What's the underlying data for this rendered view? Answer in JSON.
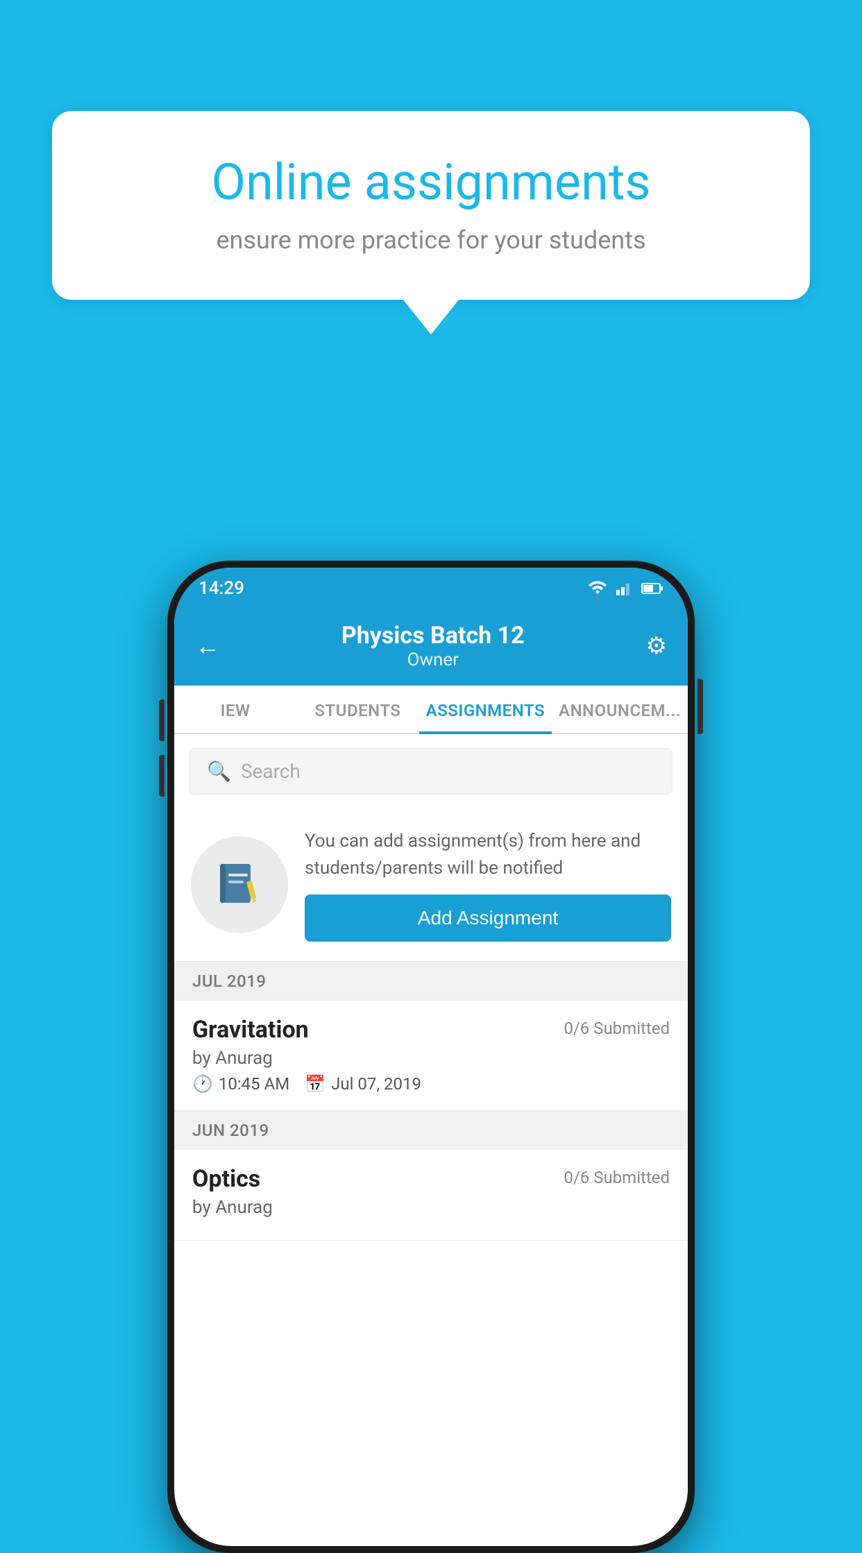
{
  "background_color": "#1bb8e8",
  "speech_bubble": {
    "title": "Online assignments",
    "subtitle": "ensure more practice for your students"
  },
  "status_bar": {
    "time": "14:29"
  },
  "header": {
    "title": "Physics Batch 12",
    "subtitle": "Owner",
    "back_label": "←",
    "gear_label": "⚙"
  },
  "tabs": [
    {
      "label": "IEW",
      "active": false
    },
    {
      "label": "STUDENTS",
      "active": false
    },
    {
      "label": "ASSIGNMENTS",
      "active": true
    },
    {
      "label": "ANNOUNCEM...",
      "active": false
    }
  ],
  "search": {
    "placeholder": "Search"
  },
  "add_assignment": {
    "description": "You can add assignment(s) from here and students/parents will be notified",
    "button_label": "Add Assignment"
  },
  "months": [
    {
      "label": "JUL 2019",
      "assignments": [
        {
          "name": "Gravitation",
          "submitted": "0/6 Submitted",
          "by": "by Anurag",
          "time": "10:45 AM",
          "date": "Jul 07, 2019"
        }
      ]
    },
    {
      "label": "JUN 2019",
      "assignments": [
        {
          "name": "Optics",
          "submitted": "0/6 Submitted",
          "by": "by Anurag",
          "time": "",
          "date": ""
        }
      ]
    }
  ]
}
